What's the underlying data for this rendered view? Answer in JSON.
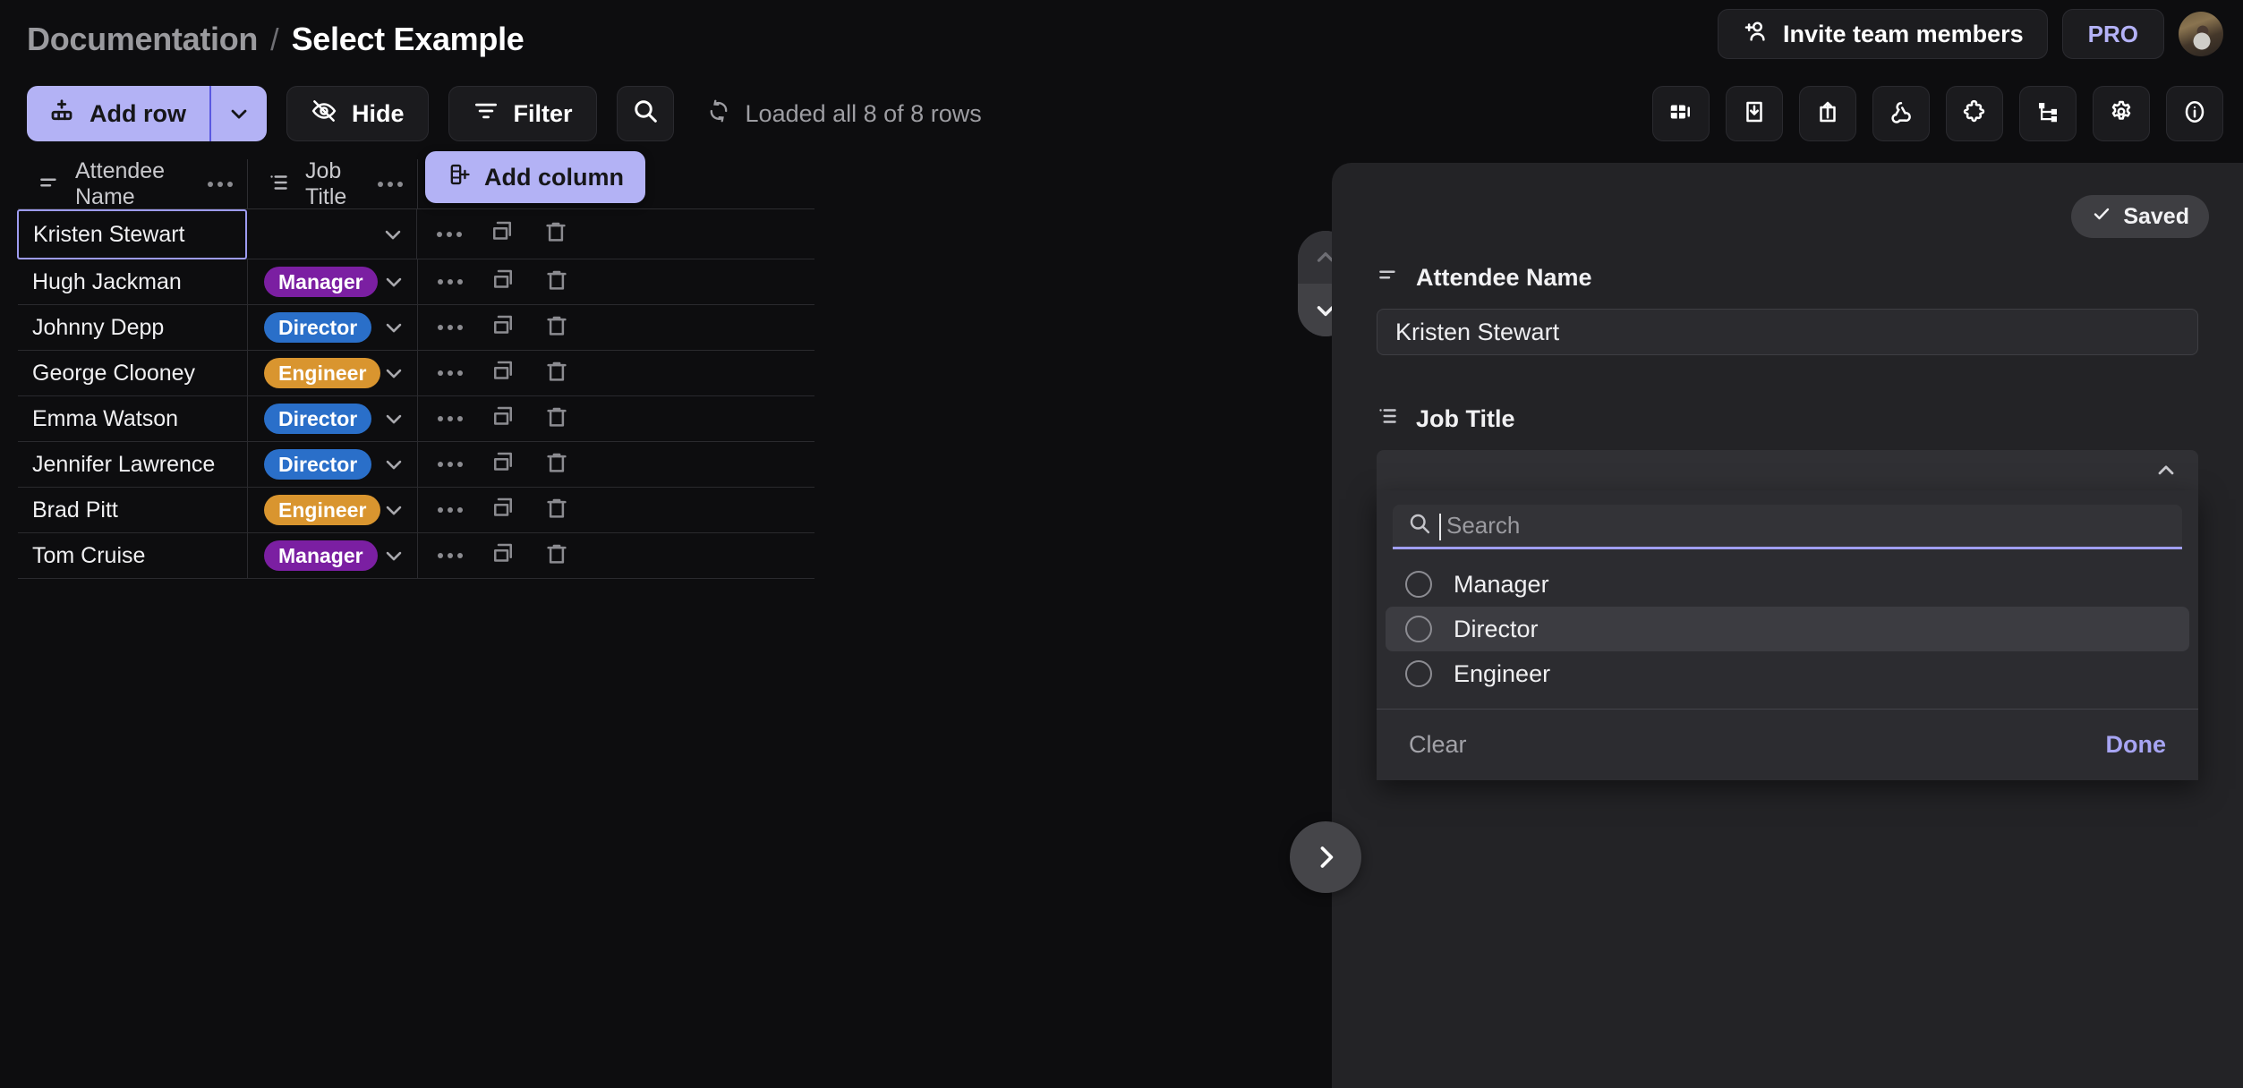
{
  "header": {
    "breadcrumb_parent": "Documentation",
    "breadcrumb_separator": "/",
    "breadcrumb_current": "Select Example",
    "invite_label": "Invite team members",
    "pro_label": "PRO"
  },
  "toolbar": {
    "add_row_label": "Add row",
    "hide_label": "Hide",
    "filter_label": "Filter",
    "status_label": "Loaded all 8 of 8 rows",
    "right_icons": [
      "grid-view-icon",
      "download-icon",
      "upload-icon",
      "webhook-icon",
      "extension-icon",
      "hierarchy-icon",
      "gear-icon",
      "info-icon"
    ]
  },
  "table": {
    "columns": [
      {
        "label": "Attendee Name",
        "icon": "text-field-icon"
      },
      {
        "label": "Job Title",
        "icon": "select-field-icon"
      }
    ],
    "add_column_label": "Add column",
    "rows": [
      {
        "name": "Kristen Stewart",
        "job": "",
        "badge_color": ""
      },
      {
        "name": "Hugh Jackman",
        "job": "Manager",
        "badge_color": "#7b1fa2"
      },
      {
        "name": "Johnny Depp",
        "job": "Director",
        "badge_color": "#2a6fc9"
      },
      {
        "name": "George Clooney",
        "job": "Engineer",
        "badge_color": "#d9952f"
      },
      {
        "name": "Emma Watson",
        "job": "Director",
        "badge_color": "#2a6fc9"
      },
      {
        "name": "Jennifer Lawrence",
        "job": "Director",
        "badge_color": "#2a6fc9"
      },
      {
        "name": "Brad Pitt",
        "job": "Engineer",
        "badge_color": "#d9952f"
      },
      {
        "name": "Tom Cruise",
        "job": "Manager",
        "badge_color": "#7b1fa2"
      }
    ]
  },
  "panel": {
    "saved_label": "Saved",
    "attendee_label": "Attendee Name",
    "attendee_value": "Kristen Stewart",
    "job_title_label": "Job Title",
    "job_title_value": "",
    "dropdown": {
      "search_placeholder": "Search",
      "search_value": "",
      "options": [
        {
          "label": "Manager",
          "highlighted": false
        },
        {
          "label": "Director",
          "highlighted": true
        },
        {
          "label": "Engineer",
          "highlighted": false
        }
      ],
      "clear_label": "Clear",
      "done_label": "Done"
    }
  },
  "colors": {
    "accent": "#b3b2f5",
    "panel_bg": "#232326",
    "app_bg": "#0d0d0f"
  }
}
